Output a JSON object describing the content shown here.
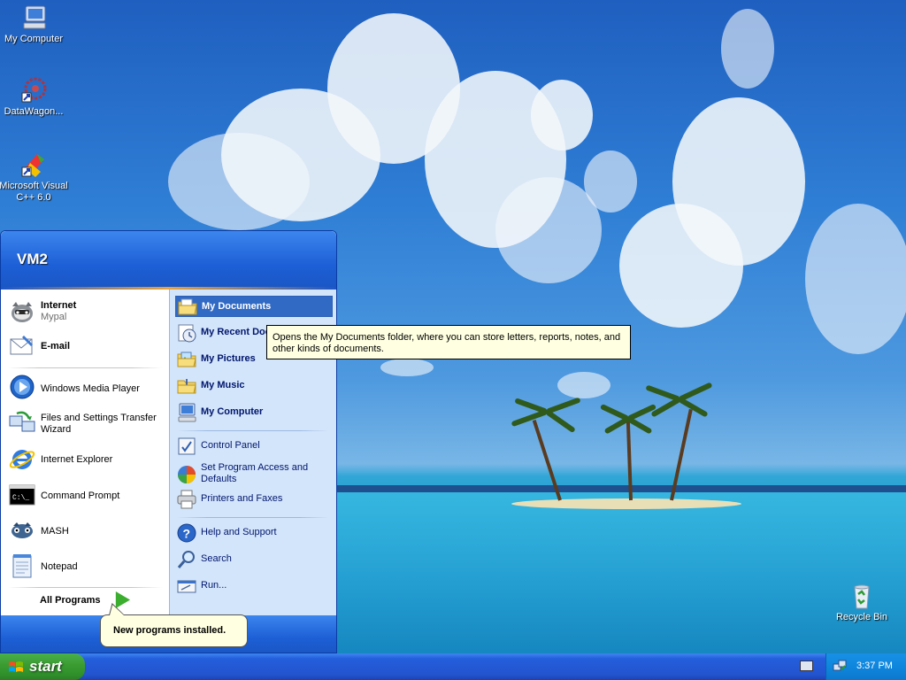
{
  "desktop": {
    "icons": [
      {
        "label": "My Computer",
        "icon": "computer-icon"
      },
      {
        "label": "DataWagon...",
        "icon": "datawagon-icon"
      },
      {
        "label": "Microsoft Visual C++ 6.0",
        "icon": "visual-cpp-icon"
      },
      {
        "label": "Recycle Bin",
        "icon": "recycle-bin-icon"
      }
    ]
  },
  "start_menu": {
    "user": "VM2",
    "left": {
      "pinned": [
        {
          "label": "Internet",
          "sub": "Mypal",
          "icon": "mypal-browser-icon"
        },
        {
          "label": "E-mail",
          "icon": "email-icon"
        }
      ],
      "recent": [
        {
          "label": "Windows Media Player",
          "icon": "media-player-icon"
        },
        {
          "label": "Files and Settings Transfer Wizard",
          "icon": "transfer-wizard-icon"
        },
        {
          "label": "Internet Explorer",
          "icon": "ie-icon"
        },
        {
          "label": "Command Prompt",
          "icon": "cmd-icon"
        },
        {
          "label": "MASH",
          "icon": "mash-icon"
        },
        {
          "label": "Notepad",
          "icon": "notepad-icon"
        }
      ],
      "all_programs": "All Programs"
    },
    "right": {
      "places": [
        {
          "label": "My Documents",
          "icon": "folder-documents-icon"
        },
        {
          "label": "My Recent Documents",
          "icon": "recent-docs-icon"
        },
        {
          "label": "My Pictures",
          "icon": "folder-pictures-icon"
        },
        {
          "label": "My Music",
          "icon": "folder-music-icon"
        },
        {
          "label": "My Computer",
          "icon": "computer-icon"
        }
      ],
      "settings": [
        {
          "label": "Control Panel",
          "icon": "control-panel-icon"
        },
        {
          "label": "Set Program Access and Defaults",
          "icon": "program-access-icon"
        },
        {
          "label": "Printers and Faxes",
          "icon": "printer-icon"
        }
      ],
      "tools": [
        {
          "label": "Help and Support",
          "icon": "help-icon"
        },
        {
          "label": "Search",
          "icon": "search-icon"
        },
        {
          "label": "Run...",
          "icon": "run-icon"
        }
      ]
    },
    "tooltip": "Opens the My Documents folder, where you can store letters, reports, notes, and other kinds of documents."
  },
  "balloon": {
    "text": "New programs installed."
  },
  "taskbar": {
    "start_label": "start",
    "clock": "3:37 PM"
  },
  "colors": {
    "selection": "#316ac5",
    "taskbar": "#245edb",
    "start_green": "#3c9d33",
    "tooltip_bg": "#ffffe1"
  }
}
